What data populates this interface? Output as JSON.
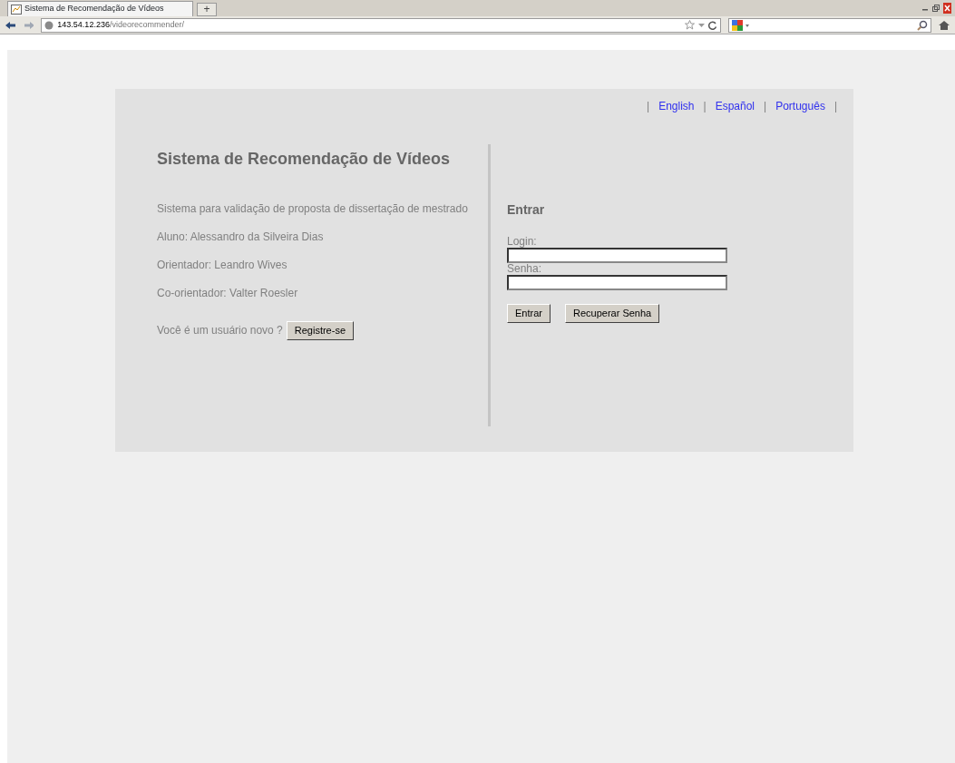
{
  "browser": {
    "tab_title": "Sistema de Recomendação de Vídeos",
    "new_tab": "+",
    "url_host": "143.54.12.236",
    "url_path": "/videorecommender/"
  },
  "language_bar": [
    {
      "kind": "separator",
      "text": "|"
    },
    {
      "kind": "link",
      "text": "English"
    },
    {
      "kind": "separator",
      "text": "|"
    },
    {
      "kind": "link",
      "text": "Español"
    },
    {
      "kind": "separator",
      "text": "|"
    },
    {
      "kind": "link",
      "text": "Português"
    },
    {
      "kind": "separator",
      "text": "|"
    }
  ],
  "info": {
    "title": "Sistema de Recomendação de Vídeos",
    "lines": [
      "Sistema para validação de proposta de dissertação de mestrado",
      "Aluno: Alessandro da Silveira Dias",
      "Orientador: Leandro Wives",
      "Co-orientador: Valter Roesler"
    ],
    "new_user_text": "Você é um usuário novo ?",
    "register_button": "Registre-se"
  },
  "login": {
    "title": "Entrar",
    "fields": [
      {
        "label": "Login:"
      },
      {
        "label": "Senha:"
      }
    ],
    "buttons": [
      "Entrar",
      "Recuperar Senha"
    ]
  }
}
